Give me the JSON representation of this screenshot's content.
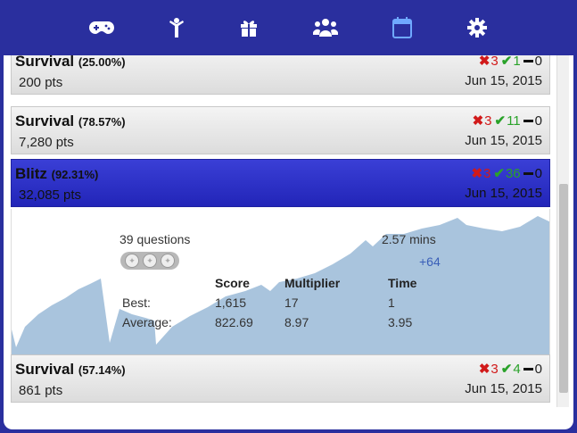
{
  "nav": {
    "icons": [
      {
        "name": "gamepad-icon",
        "active": false
      },
      {
        "name": "person-icon",
        "active": false
      },
      {
        "name": "gift-icon",
        "active": false
      },
      {
        "name": "group-icon",
        "active": false
      },
      {
        "name": "calendar-icon",
        "active": true
      },
      {
        "name": "gear-icon",
        "active": false
      }
    ]
  },
  "rows": [
    {
      "title": "Survival",
      "percent": "(25.00%)",
      "points": "200 pts",
      "date": "Jun 15, 2015",
      "wrong": "3",
      "right": "1",
      "skipped": "0"
    },
    {
      "title": "Survival",
      "percent": "(78.57%)",
      "points": "7,280 pts",
      "date": "Jun 15, 2015",
      "wrong": "3",
      "right": "11",
      "skipped": "0"
    },
    {
      "title": "Blitz",
      "percent": "(92.31%)",
      "points": "32,085 pts",
      "date": "Jun 15, 2015",
      "wrong": "3",
      "right": "36",
      "skipped": "0"
    },
    {
      "title": "Survival",
      "percent": "(57.14%)",
      "points": "861 pts",
      "date": "Jun 15, 2015",
      "wrong": "3",
      "right": "4",
      "skipped": "0"
    }
  ],
  "detail": {
    "questions": "39 questions",
    "duration": "2.57 mins",
    "bonus": "+64",
    "headers": {
      "score": "Score",
      "multiplier": "Multiplier",
      "time": "Time"
    },
    "best": {
      "label": "Best:",
      "score": "1,615",
      "multiplier": "17",
      "time": "1"
    },
    "average": {
      "label": "Average:",
      "score": "822.69",
      "multiplier": "8.97",
      "time": "3.95"
    },
    "chart_fill_color": "#a9c4dd"
  },
  "colors": {
    "nav_bg": "#2a2f9e",
    "active_row": "#2a2fc8",
    "wrong": "#d11a1a",
    "right": "#2aa22a",
    "active_icon": "#6fa8ff"
  }
}
